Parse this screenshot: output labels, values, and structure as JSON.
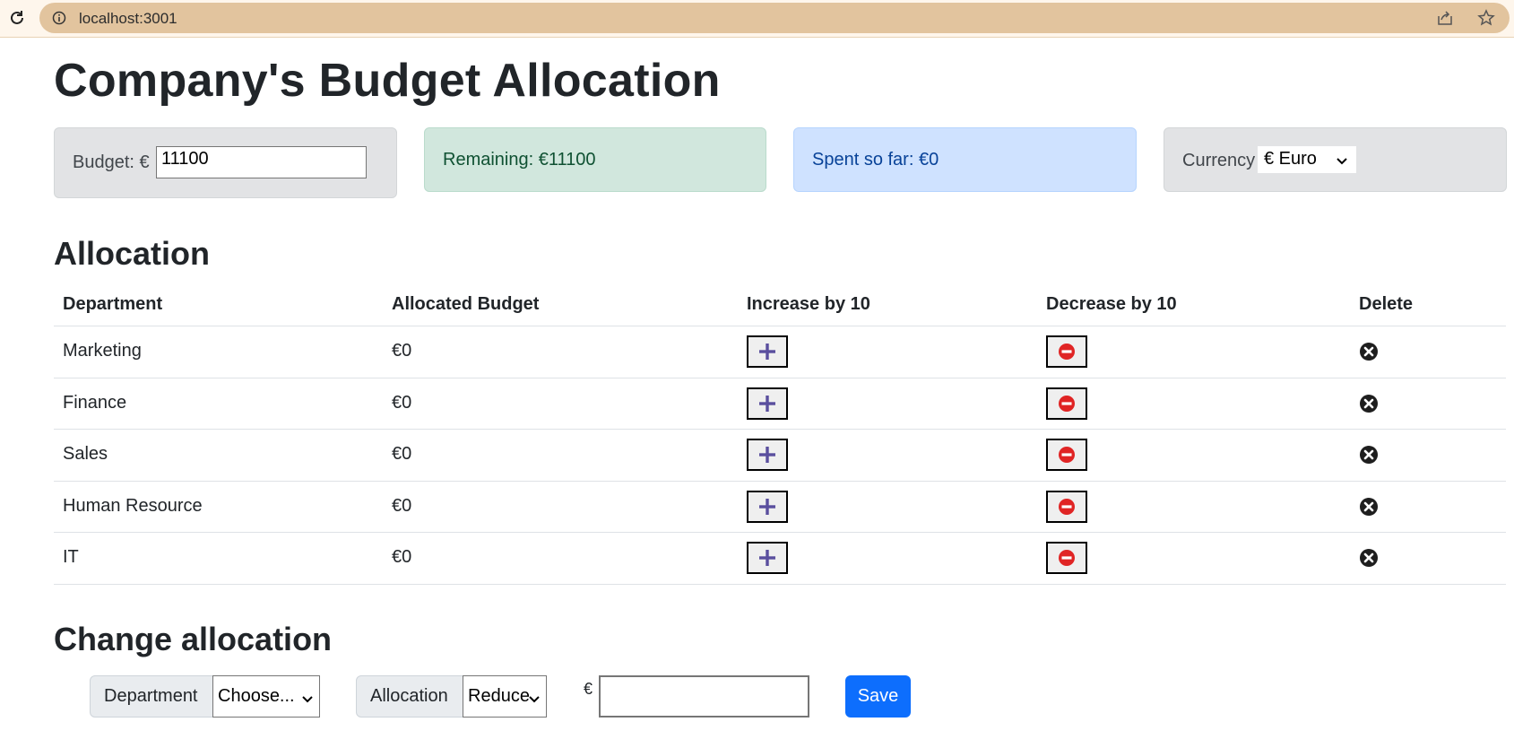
{
  "browser": {
    "url": "localhost:3001"
  },
  "page": {
    "title": "Company's Budget Allocation"
  },
  "cards": {
    "budget_label": "Budget: €",
    "budget_value": "11100",
    "remaining": "Remaining: €11100",
    "spent": "Spent so far: €0",
    "currency_label": "Currency",
    "currency_selected": "€ Euro"
  },
  "allocation": {
    "heading": "Allocation",
    "columns": [
      "Department",
      "Allocated Budget",
      "Increase by 10",
      "Decrease by 10",
      "Delete"
    ],
    "rows": [
      {
        "department": "Marketing",
        "budget": "€0"
      },
      {
        "department": "Finance",
        "budget": "€0"
      },
      {
        "department": "Sales",
        "budget": "€0"
      },
      {
        "department": "Human Resource",
        "budget": "€0"
      },
      {
        "department": "IT",
        "budget": "€0"
      }
    ]
  },
  "change": {
    "heading": "Change allocation",
    "department_label": "Department",
    "department_selected": "Choose...",
    "allocation_label": "Allocation",
    "allocation_selected": "Reduce",
    "currency_symbol": "€",
    "amount_value": "",
    "save_label": "Save"
  },
  "colors": {
    "primary": "#0d6efd",
    "increase_icon": "#5a4f9e",
    "decrease_icon": "#e02424"
  }
}
